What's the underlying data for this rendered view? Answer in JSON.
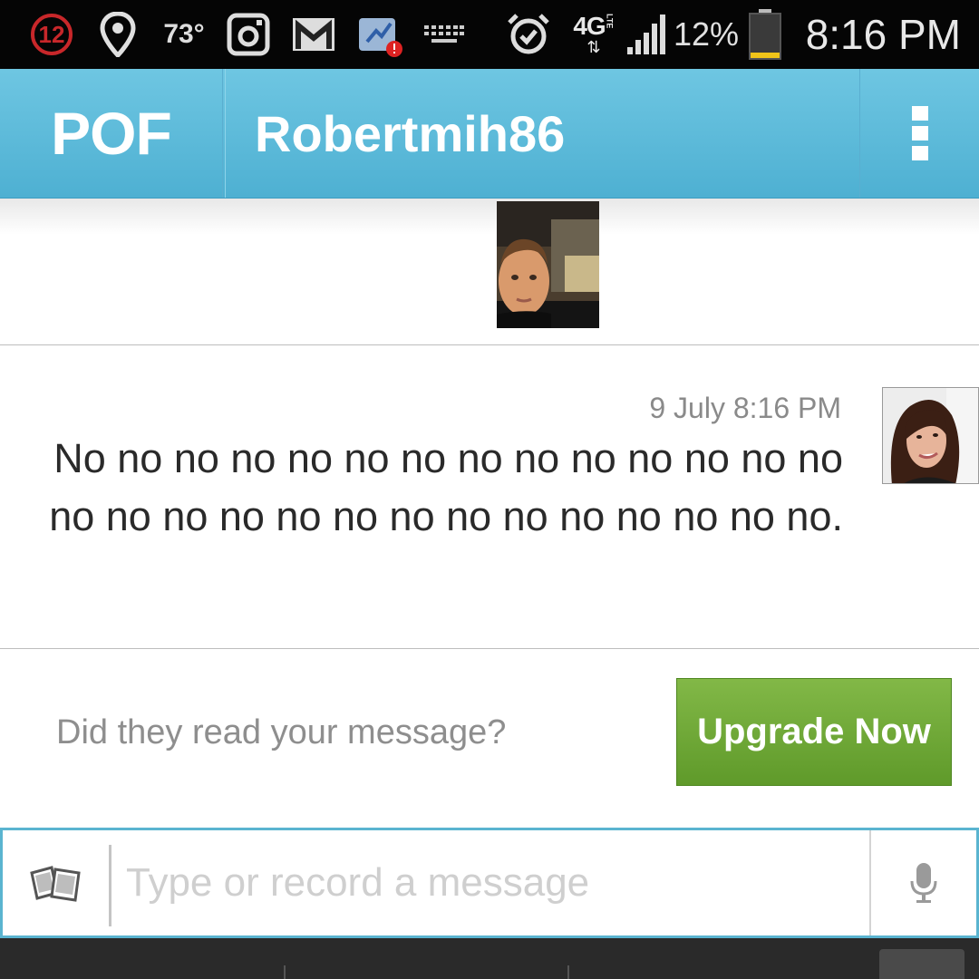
{
  "status_bar": {
    "notification_count": "12",
    "temperature": "73°",
    "battery_percent": "12%",
    "time": "8:16 PM",
    "network": "4G",
    "network_sub": "LTE"
  },
  "action_bar": {
    "app_logo": "POF",
    "title": "Robertmih86",
    "menu_icon": "overflow-menu-icon"
  },
  "message": {
    "timestamp": "9 July 8:16 PM",
    "text": "No no no no no no no no no no no no no no no no no no no no no no no no no no no no."
  },
  "upgrade": {
    "question": "Did they read your message?",
    "button_label": "Upgrade Now"
  },
  "composer": {
    "placeholder": "Type or record a message",
    "value": ""
  },
  "colors": {
    "action_bar": "#5ab9d9",
    "upgrade_button": "#6ea637",
    "status_bar": "#050505",
    "notification_ring": "#c8272a"
  }
}
